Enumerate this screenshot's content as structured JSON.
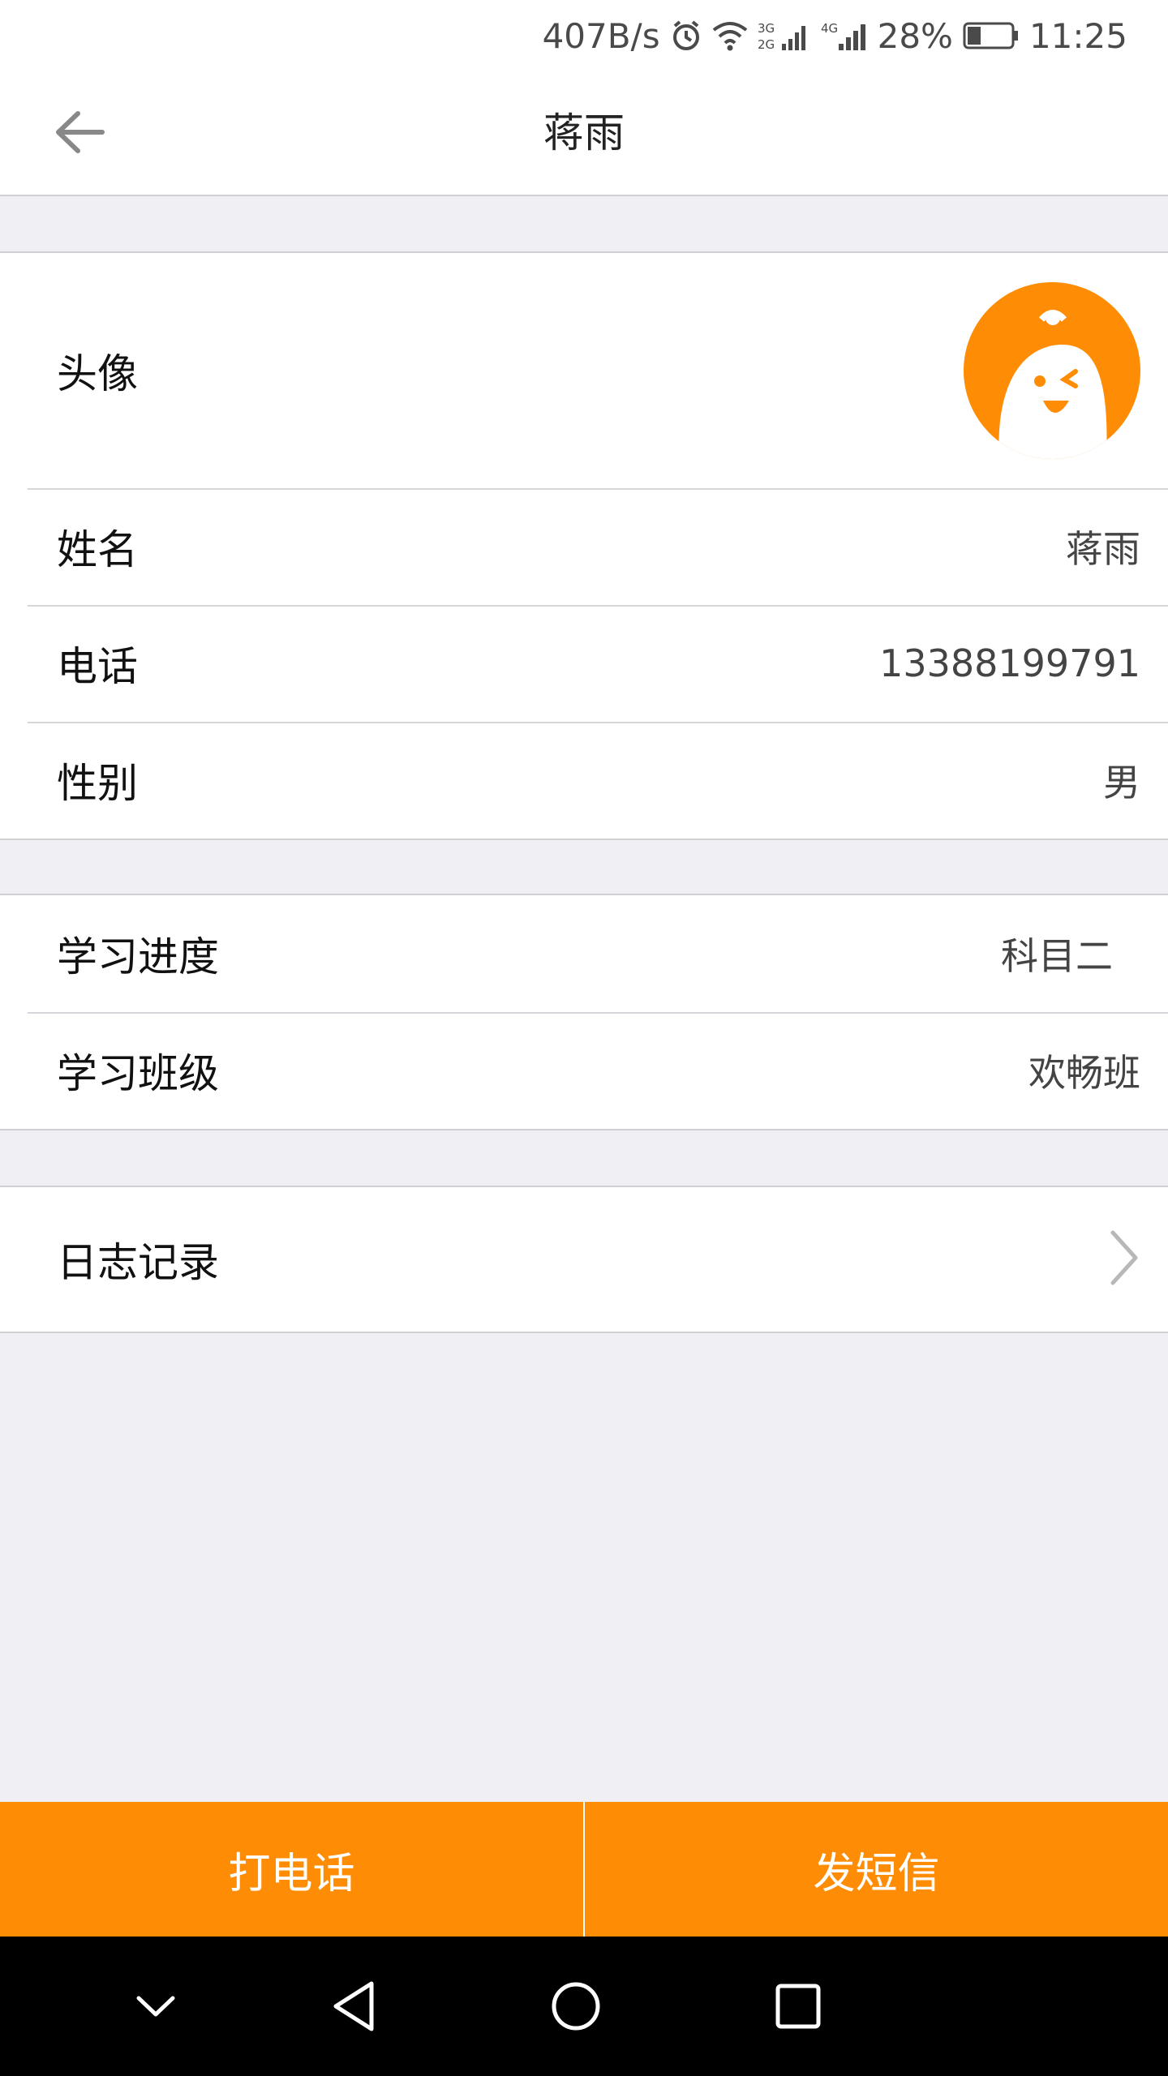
{
  "status_bar": {
    "net_speed": "407B/s",
    "battery_percent": "28%",
    "time": "11:25",
    "icons": [
      "alarm-icon",
      "wifi-icon",
      "signal-3g-2g-icon",
      "signal-4g-icon",
      "battery-icon"
    ]
  },
  "header": {
    "title": "蒋雨",
    "back_icon": "arrow-left-icon"
  },
  "profile": {
    "avatar_label": "头像",
    "name_label": "姓名",
    "name_value": "蒋雨",
    "phone_label": "电话",
    "phone_value": "13388199791",
    "gender_label": "性别",
    "gender_value": "男"
  },
  "study": {
    "progress_label": "学习进度",
    "progress_value": "科目二",
    "class_label": "学习班级",
    "class_value": "欢畅班"
  },
  "log": {
    "label": "日志记录",
    "chevron_icon": "chevron-right-icon"
  },
  "actions": {
    "call_label": "打电话",
    "sms_label": "发短信"
  },
  "system_nav": {
    "icons": [
      "chevron-down-icon",
      "back-triangle-icon",
      "home-circle-icon",
      "recents-square-icon"
    ]
  },
  "colors": {
    "accent": "#ff8c05",
    "page_bg": "#efeff4"
  }
}
